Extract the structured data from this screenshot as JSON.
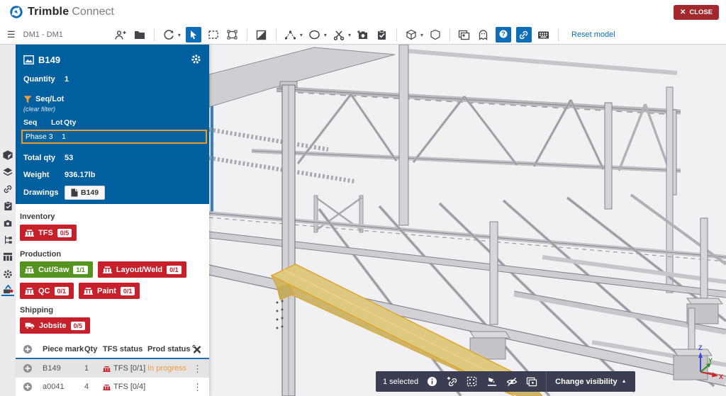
{
  "header": {
    "brand_bold": "Trimble",
    "brand_rest": "Connect",
    "close_label": "CLOSE"
  },
  "toolbar": {
    "project": "DM1 - DM1",
    "reset": "Reset model"
  },
  "glyphs": {
    "menu": "☰",
    "caret": "▾",
    "close_x": "✕",
    "kebab": "⋮",
    "up_caret": "▲",
    "question": "?"
  },
  "panel": {
    "title": "B149",
    "quantity_label": "Quantity",
    "quantity_value": "1",
    "filter_title": "Seq/Lot",
    "clear_filter": "(clear filter)",
    "col_seq": "Seq",
    "col_lot": "Lot",
    "col_qty": "Qty",
    "phase_row": {
      "seq": "Phase 3",
      "qty": "1"
    },
    "total_label": "Total qty",
    "total_value": "53",
    "weight_label": "Weight",
    "weight_value": "936.17lb",
    "drawings_label": "Drawings",
    "drawing_button": "B149"
  },
  "statuses": {
    "inventory_label": "Inventory",
    "production_label": "Production",
    "shipping_label": "Shipping",
    "tfs": {
      "label": "TFS",
      "count": "0/5"
    },
    "cut_saw": {
      "label": "Cut/Saw",
      "count": "1/1"
    },
    "layout_weld": {
      "label": "Layout/Weld",
      "count": "0/1"
    },
    "qc": {
      "label": "QC",
      "count": "0/1"
    },
    "paint": {
      "label": "Paint",
      "count": "0/1"
    },
    "jobsite": {
      "label": "Jobsite",
      "count": "0/5"
    }
  },
  "table": {
    "col_piece": "Piece mark",
    "col_qty": "Qty",
    "col_tfs": "TFS status",
    "col_prod": "Prod status",
    "rows": [
      {
        "piece": "B149",
        "qty": "1",
        "tfs": "TFS [0/1]",
        "prod": "In progress"
      },
      {
        "piece": "a0041",
        "qty": "4",
        "tfs": "TFS [0/4]",
        "prod": ""
      }
    ]
  },
  "selection_bar": {
    "selected": "1 selected",
    "change_visibility": "Change visibility"
  },
  "gizmo": {
    "x": "X",
    "y": "Y",
    "z": "Z"
  },
  "colors": {
    "brand_blue": "#005f9e",
    "accent_blue": "#0d6db7",
    "status_red": "#c8202a",
    "status_green": "#55941f",
    "close_red": "#a3292d",
    "highlight_orange": "#e79b35",
    "in_progress_orange": "#f59a3d",
    "selected_beam": "#d8c26e"
  }
}
